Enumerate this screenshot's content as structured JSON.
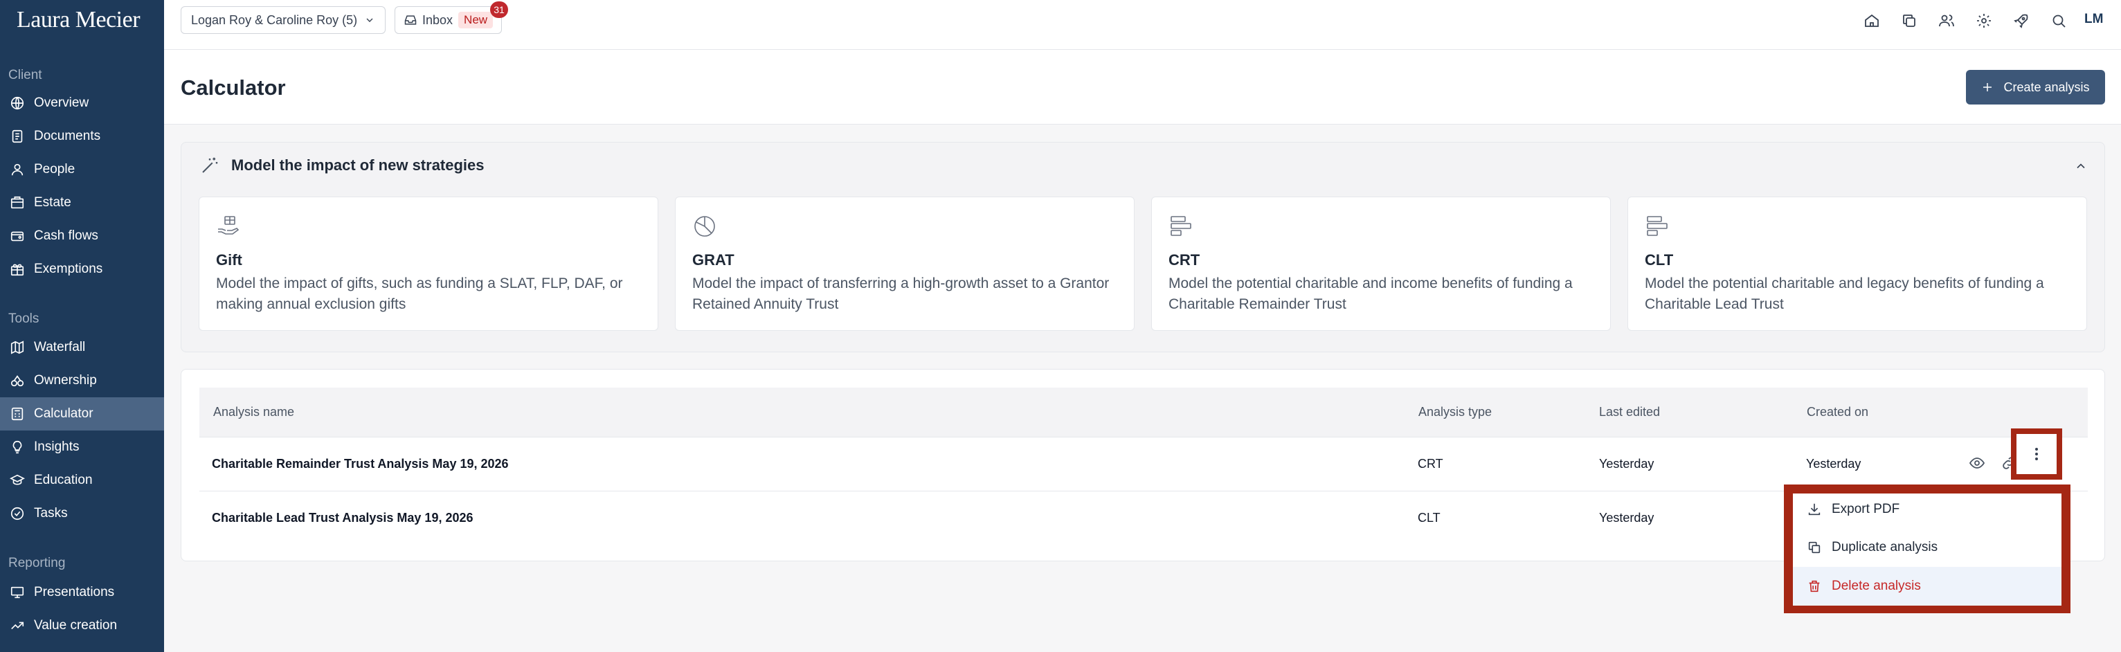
{
  "app": {
    "logo": "Laura Mecier",
    "user_initials": "LM"
  },
  "sidebar": {
    "sections": [
      {
        "label": "Client",
        "items": [
          {
            "label": "Overview",
            "icon": "globe-icon"
          },
          {
            "label": "Documents",
            "icon": "document-icon"
          },
          {
            "label": "People",
            "icon": "person-icon"
          },
          {
            "label": "Estate",
            "icon": "estate-icon"
          },
          {
            "label": "Cash flows",
            "icon": "cash-icon"
          },
          {
            "label": "Exemptions",
            "icon": "gift-icon"
          }
        ]
      },
      {
        "label": "Tools",
        "items": [
          {
            "label": "Waterfall",
            "icon": "map-icon"
          },
          {
            "label": "Ownership",
            "icon": "ownership-icon"
          },
          {
            "label": "Calculator",
            "icon": "calculator-icon",
            "active": true
          },
          {
            "label": "Insights",
            "icon": "lightbulb-icon"
          },
          {
            "label": "Education",
            "icon": "graduation-icon"
          },
          {
            "label": "Tasks",
            "icon": "check-circle-icon"
          }
        ]
      },
      {
        "label": "Reporting",
        "items": [
          {
            "label": "Presentations",
            "icon": "presentation-icon"
          },
          {
            "label": "Value creation",
            "icon": "trend-up-icon"
          }
        ]
      }
    ]
  },
  "topbar": {
    "client_selector": "Logan Roy & Caroline Roy (5)",
    "inbox_label": "Inbox",
    "inbox_new": "New",
    "inbox_count": "31"
  },
  "header": {
    "title": "Calculator",
    "create_label": "Create analysis"
  },
  "strategies": {
    "title": "Model the impact of new strategies",
    "cards": [
      {
        "title": "Gift",
        "desc": "Model the impact of gifts, such as funding a SLAT, FLP, DAF, or making annual exclusion gifts"
      },
      {
        "title": "GRAT",
        "desc": "Model the impact of transferring a high-growth asset to a Grantor Retained Annuity Trust"
      },
      {
        "title": "CRT",
        "desc": "Model the potential charitable and income benefits of funding a Charitable Remainder Trust"
      },
      {
        "title": "CLT",
        "desc": "Model the potential charitable and legacy benefits of funding a Charitable Lead Trust"
      }
    ]
  },
  "table": {
    "columns": [
      "Analysis name",
      "Analysis type",
      "Last edited",
      "Created on"
    ],
    "rows": [
      {
        "name": "Charitable Remainder Trust Analysis May 19, 2026",
        "type": "CRT",
        "edited": "Yesterday",
        "created": "Yesterday"
      },
      {
        "name": "Charitable Lead Trust Analysis May 19, 2026",
        "type": "CLT",
        "edited": "Yesterday",
        "created": ""
      }
    ]
  },
  "menu": {
    "items": [
      {
        "label": "Export PDF"
      },
      {
        "label": "Duplicate analysis"
      },
      {
        "label": "Delete analysis"
      }
    ]
  }
}
